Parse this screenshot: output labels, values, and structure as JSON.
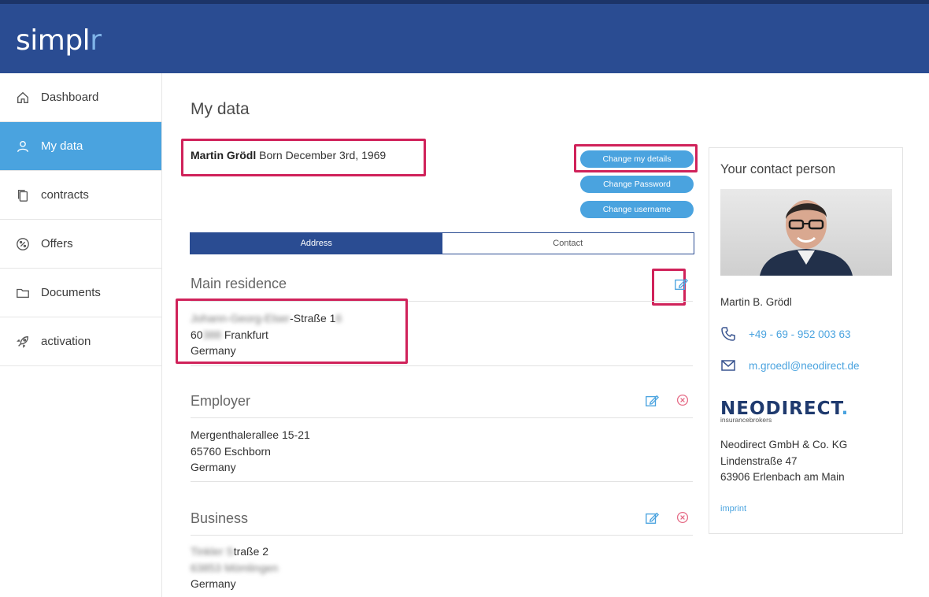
{
  "app": {
    "logo_main": "simpl",
    "logo_accent": "r"
  },
  "sidebar": {
    "items": [
      {
        "label": "Dashboard",
        "icon": "home-icon"
      },
      {
        "label": "My data",
        "icon": "user-icon",
        "active": true
      },
      {
        "label": "contracts",
        "icon": "copy-icon"
      },
      {
        "label": "Offers",
        "icon": "percent-icon"
      },
      {
        "label": "Documents",
        "icon": "folder-icon"
      },
      {
        "label": "activation",
        "icon": "rocket-icon"
      }
    ]
  },
  "main": {
    "title": "My data",
    "person": {
      "name": "Martin Grödl",
      "born": "Born December 3rd, 1969"
    },
    "buttons": {
      "change_details": "Change my details",
      "change_password": "Change Password",
      "change_username": "Change username"
    },
    "tabs": [
      {
        "label": "Address",
        "active": true
      },
      {
        "label": "Contact",
        "active": false
      }
    ],
    "sections": [
      {
        "title": "Main residence",
        "line1_blurred": "Johann-Georg-Elser",
        "line1_clear": "-Straße 1",
        "line1_blurred_tail": "6",
        "line2_clear_head": "60",
        "line2_blurred": "388",
        "line2_clear": " Frankfurt",
        "line3": "Germany"
      },
      {
        "title": "Employer",
        "line1": "Mergenthalerallee 15-21",
        "line2": "65760 Eschborn",
        "line3": "Germany"
      },
      {
        "title": "Business",
        "line1_blurred": "Tinkler S",
        "line1_clear": "traße 2",
        "line2_blurred": "63853 Mömlingen",
        "line3": "Germany"
      }
    ]
  },
  "contact_card": {
    "title": "Your contact person",
    "name": "Martin B. Grödl",
    "phone": "+49 - 69 - 952 003 63",
    "email": "m.groedl@neodirect.de",
    "company_logo_word": "NEODIRECT",
    "company_logo_dot": ".",
    "company_logo_tag": "insurancebrokers",
    "company_name": "Neodirect GmbH & Co. KG",
    "company_street": "Lindenstraße 47",
    "company_city": "63906 Erlenbach am Main",
    "imprint": "imprint"
  },
  "colors": {
    "header": "#2a4c92",
    "accent": "#4aa3df",
    "highlight": "#d0225a"
  }
}
